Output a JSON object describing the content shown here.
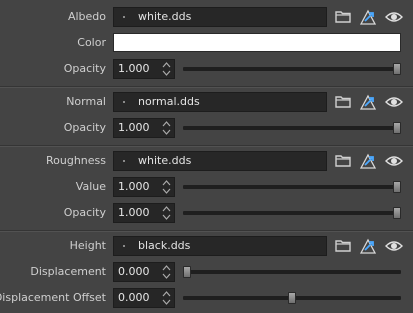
{
  "sections": [
    {
      "map": {
        "label": "Albedo",
        "file": "white.dds"
      },
      "color": {
        "label": "Color",
        "value": "#ffffff"
      },
      "params": [
        {
          "label": "Opacity",
          "value": "1.000",
          "level": 1.0
        }
      ]
    },
    {
      "map": {
        "label": "Normal",
        "file": "normal.dds"
      },
      "params": [
        {
          "label": "Opacity",
          "value": "1.000",
          "level": 1.0
        }
      ]
    },
    {
      "map": {
        "label": "Roughness",
        "file": "white.dds"
      },
      "params": [
        {
          "label": "Value",
          "value": "1.000",
          "level": 1.0
        },
        {
          "label": "Opacity",
          "value": "1.000",
          "level": 1.0
        }
      ]
    },
    {
      "map": {
        "label": "Height",
        "file": "black.dds"
      },
      "params": [
        {
          "label": "Displacement",
          "value": "0.000",
          "level": 0.0
        },
        {
          "label": "Displacement Offset",
          "value": "0.000",
          "level": 0.5
        }
      ]
    }
  ],
  "icons": {
    "folder": "folder-icon",
    "reload": "reload-icon",
    "visibility": "eye-icon"
  },
  "colors": {
    "background": "#444444",
    "field": "#272727",
    "track": "#1f1f1f"
  }
}
